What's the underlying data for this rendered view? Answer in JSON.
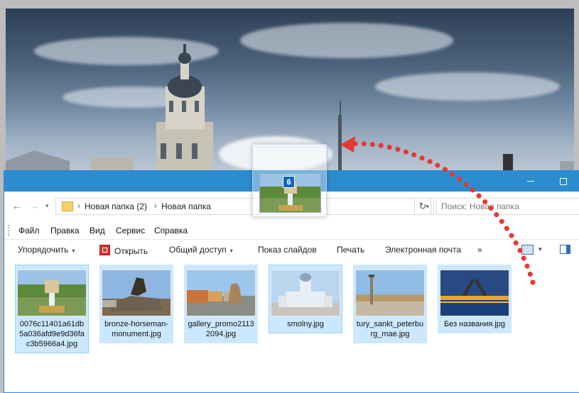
{
  "window": {
    "minimize_label": "minimize",
    "maximize_label": "maximize"
  },
  "address_bar": {
    "crumbs": [
      "Новая папка (2)",
      "Новая папка"
    ],
    "search_placeholder": "Поиск: Новая папка"
  },
  "menu": [
    "Файл",
    "Правка",
    "Вид",
    "Сервис",
    "Справка"
  ],
  "toolbar": {
    "organize": "Упорядочить",
    "open": "Открыть",
    "share": "Общий доступ",
    "slideshow": "Показ слайдов",
    "print": "Печать",
    "email": "Электронная почта",
    "more": "»"
  },
  "files": [
    {
      "name": "0076c11401a61db5a036afd9e9d36fac3b5966a4.jpg",
      "selected": true
    },
    {
      "name": "bronze-horseman-monument.jpg",
      "selected": true
    },
    {
      "name": "gallery_promo21132094.jpg",
      "selected": true
    },
    {
      "name": "smolny.jpg",
      "selected": true
    },
    {
      "name": "tury_sankt_peterburg_mae.jpg",
      "selected": true
    },
    {
      "name": "Без названия.jpg",
      "selected": true
    }
  ],
  "drag": {
    "count": "6"
  },
  "colors": {
    "titlebar": "#2b8ccf",
    "selection": "#cce8ff",
    "arrow": "#e53935"
  }
}
